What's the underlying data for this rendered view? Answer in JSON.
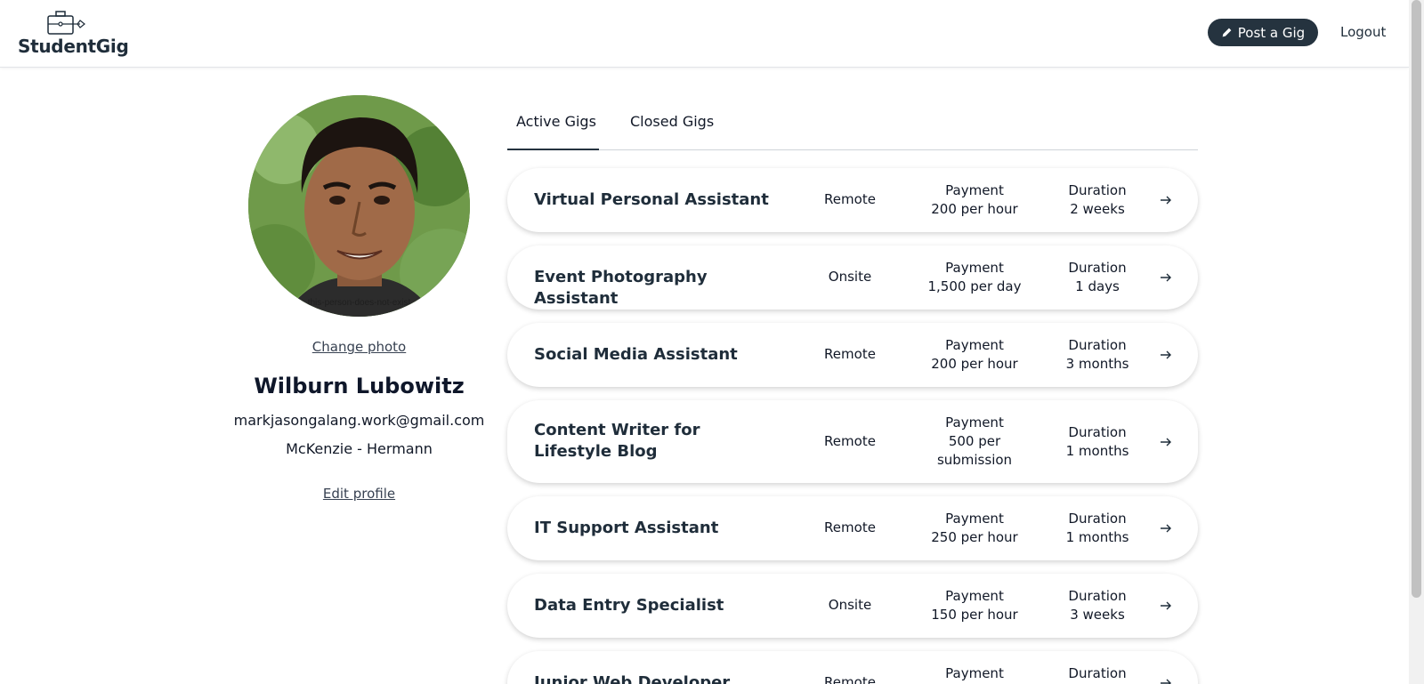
{
  "brand": {
    "name": "StudentGig"
  },
  "header": {
    "post_label": "Post a Gig",
    "logout_label": "Logout"
  },
  "profile": {
    "photo_caption": "this-person-does-not-exist",
    "change_photo_label": "Change photo",
    "name": "Wilburn Lubowitz",
    "email": "markjasongalang.work@gmail.com",
    "company": "McKenzie - Hermann",
    "edit_label": "Edit profile"
  },
  "tabs": [
    {
      "label": "Active Gigs",
      "active": true
    },
    {
      "label": "Closed Gigs",
      "active": false
    }
  ],
  "gigs": [
    {
      "title": "Virtual Personal Assistant",
      "location": "Remote",
      "payment_label": "Payment",
      "payment": "200 per hour",
      "duration_label": "Duration",
      "duration": "2 weeks"
    },
    {
      "title": "Event Photography Assistant",
      "location": "Onsite",
      "payment_label": "Payment",
      "payment": "1,500 per day",
      "duration_label": "Duration",
      "duration": "1 days"
    },
    {
      "title": "Social Media Assistant",
      "location": "Remote",
      "payment_label": "Payment",
      "payment": "200 per hour",
      "duration_label": "Duration",
      "duration": "3 months"
    },
    {
      "title": "Content Writer for Lifestyle Blog",
      "location": "Remote",
      "payment_label": "Payment",
      "payment": "500 per submission",
      "duration_label": "Duration",
      "duration": "1 months"
    },
    {
      "title": "IT Support Assistant",
      "location": "Remote",
      "payment_label": "Payment",
      "payment": "250 per hour",
      "duration_label": "Duration",
      "duration": "1 months"
    },
    {
      "title": "Data Entry Specialist",
      "location": "Onsite",
      "payment_label": "Payment",
      "payment": "150 per hour",
      "duration_label": "Duration",
      "duration": "3 weeks"
    },
    {
      "title": "Junior Web Developer",
      "location": "Remote",
      "payment_label": "Payment",
      "payment": "",
      "duration_label": "Duration",
      "duration": ""
    }
  ],
  "colors": {
    "primary": "#25333f",
    "text": "#1f2d3a"
  }
}
